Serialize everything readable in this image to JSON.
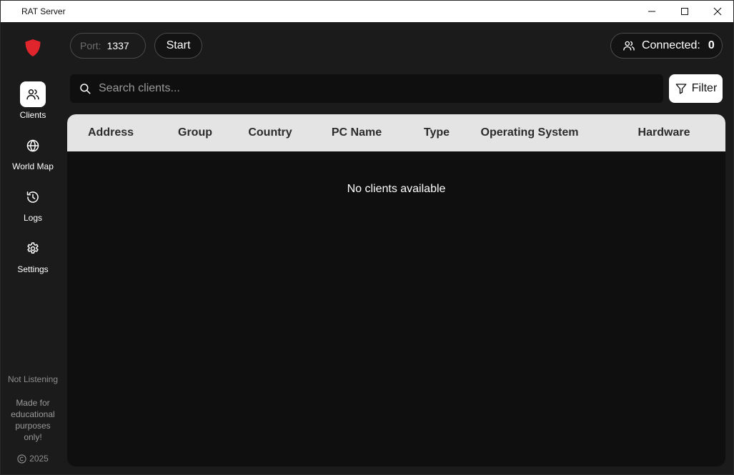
{
  "window": {
    "title": "RAT Server",
    "controls": [
      "minimize-icon",
      "maximize-icon",
      "close-icon"
    ]
  },
  "colors": {
    "accent": "#e0252d",
    "background": "#1b1b1b",
    "panel": "#0f0f0f",
    "table_header": "#e4e4e4"
  },
  "sidebar": {
    "logo_icon": "shield-icon",
    "items": [
      {
        "label": "Clients",
        "icon": "users-icon",
        "active": true
      },
      {
        "label": "World Map",
        "icon": "globe-icon",
        "active": false
      },
      {
        "label": "Logs",
        "icon": "history-icon",
        "active": false
      },
      {
        "label": "Settings",
        "icon": "gear-icon",
        "active": false
      }
    ],
    "status": "Not Listening",
    "disclaimer": [
      "Made for",
      "educational",
      "purposes",
      "only!"
    ],
    "copyright_year": "2025"
  },
  "toolbar": {
    "port_label": "Port:",
    "port_value": "1337",
    "start_label": "Start",
    "connected_label": "Connected:",
    "connected_count": "0"
  },
  "search": {
    "placeholder": "Search clients...",
    "value": "",
    "filter_label": "Filter"
  },
  "table": {
    "columns": [
      "Address",
      "Group",
      "Country",
      "PC Name",
      "Type",
      "Operating System",
      "Hardware"
    ],
    "rows": [],
    "empty_message": "No clients available"
  }
}
